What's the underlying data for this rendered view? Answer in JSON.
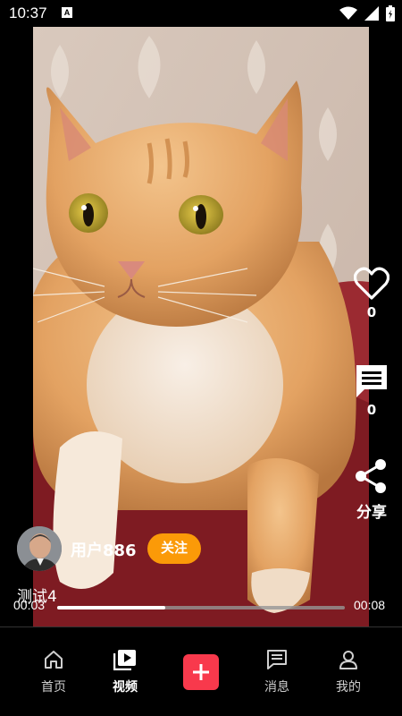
{
  "status_bar": {
    "time": "10:37",
    "notification_letter": "A",
    "icons": [
      "wifi-icon",
      "signal-icon",
      "battery-icon"
    ]
  },
  "video": {
    "subject": "orange tabby cat",
    "progress_fraction": 0.375
  },
  "actions": {
    "like_count": "0",
    "comment_count": "0",
    "share_label": "分享"
  },
  "author": {
    "username": "用户886",
    "follow_label": "关注",
    "caption": "测试4"
  },
  "playback": {
    "current_time": "00:03",
    "total_time": "00:08"
  },
  "bottom_nav": {
    "items": [
      {
        "label": "首页",
        "icon": "home-icon"
      },
      {
        "label": "视频",
        "icon": "video-icon",
        "active": true
      },
      {
        "label": "",
        "icon": "plus-icon"
      },
      {
        "label": "消息",
        "icon": "message-icon"
      },
      {
        "label": "我的",
        "icon": "profile-icon"
      }
    ]
  },
  "colors": {
    "follow": "#fb9a08",
    "add_button": "#f8394c",
    "background": "#000000"
  }
}
